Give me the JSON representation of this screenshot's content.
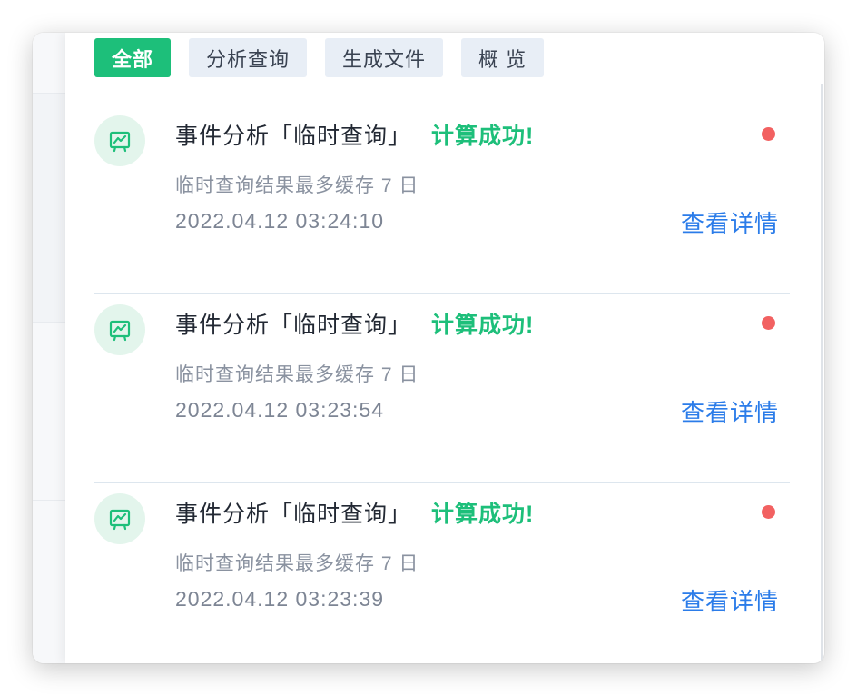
{
  "tabs": [
    {
      "label": "全部",
      "active": true
    },
    {
      "label": "分析查询",
      "active": false
    },
    {
      "label": "生成文件",
      "active": false
    },
    {
      "label": "概 览",
      "active": false
    }
  ],
  "notifications": [
    {
      "icon": "chart-screen-icon",
      "title": "事件分析「临时查询」",
      "status": "计算成功!",
      "subtitle": "临时查询结果最多缓存 7 日",
      "time": "2022.04.12 03:24:10",
      "action": "查看详情",
      "unread": true
    },
    {
      "icon": "chart-screen-icon",
      "title": "事件分析「临时查询」",
      "status": "计算成功!",
      "subtitle": "临时查询结果最多缓存 7 日",
      "time": "2022.04.12 03:23:54",
      "action": "查看详情",
      "unread": true
    },
    {
      "icon": "chart-screen-icon",
      "title": "事件分析「临时查询」",
      "status": "计算成功!",
      "subtitle": "临时查询结果最多缓存 7 日",
      "time": "2022.04.12 03:23:39",
      "action": "查看详情",
      "unread": true
    }
  ],
  "colors": {
    "accent_green": "#1dbf7a",
    "link_blue": "#2b7ce9",
    "unread_red": "#f26161",
    "tab_bg": "#e8eef6"
  }
}
